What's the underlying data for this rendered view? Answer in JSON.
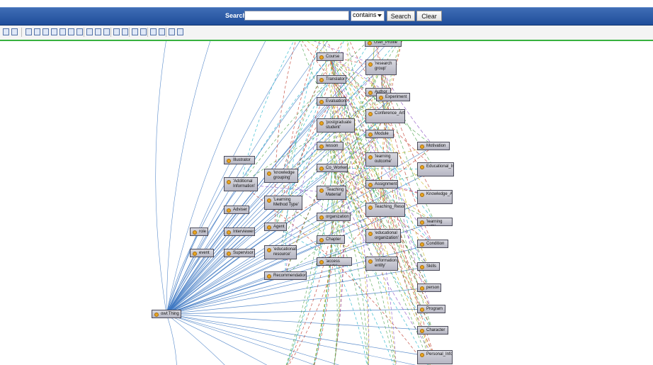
{
  "search": {
    "label": "Search:",
    "value": "",
    "mode": "contains",
    "search_button": "Search",
    "clear_button": "Clear"
  },
  "toolbar": {
    "icons": [
      "collapse-icon",
      "expand-icon",
      "list-icon",
      "tree-icon",
      "layout-icon",
      "triangle-layout-icon",
      "left-layout-icon",
      "center-layout-icon",
      "right-layout-icon",
      "zoom-in-icon",
      "zoom-out-icon",
      "zoom-fit-icon",
      "hierarchy-icon",
      "filter-icon",
      "camera-icon",
      "save-icon",
      "save-image-icon",
      "open-icon",
      "export-icon",
      "options-icon"
    ]
  },
  "colors": {
    "header": "#2a5ba8",
    "toolbar_accent": "#38b13f",
    "node_dot": "#e8a521",
    "edge_blue": "#3c77c2",
    "edge_red": "#c0392b",
    "edge_green": "#4aa14a",
    "edge_purple": "#8a4fc2",
    "edge_cyan": "#19b3c9",
    "edge_yellow": "#c9b21a"
  },
  "graph": {
    "nodes": [
      {
        "id": "userprofile",
        "label": "User_Profile"
      },
      {
        "id": "course",
        "label": "Course"
      },
      {
        "id": "researchgroup",
        "label": "'research group'"
      },
      {
        "id": "translator",
        "label": "Translator"
      },
      {
        "id": "author",
        "label": "Author"
      },
      {
        "id": "experiment",
        "label": "Experiment"
      },
      {
        "id": "evaluation",
        "label": "Evaluation"
      },
      {
        "id": "conference",
        "label": "Conference_Article"
      },
      {
        "id": "postgrad",
        "label": "'postgraduate student'"
      },
      {
        "id": "module",
        "label": "Module"
      },
      {
        "id": "lesson",
        "label": "lesson"
      },
      {
        "id": "learningoutcome",
        "label": "'learning outcome'"
      },
      {
        "id": "motivation",
        "label": "Motivation"
      },
      {
        "id": "illustrator",
        "label": "Illustrator"
      },
      {
        "id": "coworker",
        "label": "Co_Worker"
      },
      {
        "id": "educinfo",
        "label": "Educational_Information"
      },
      {
        "id": "knowledgegrouping",
        "label": "'knowledge grouping'"
      },
      {
        "id": "addinfo",
        "label": "'Additional Information'"
      },
      {
        "id": "teachingmaterial",
        "label": "'Teaching Material'"
      },
      {
        "id": "assignment",
        "label": "Assignment"
      },
      {
        "id": "knowledgeability",
        "label": "Knowledge_Ability"
      },
      {
        "id": "lmt",
        "label": "'Learning Method Type'"
      },
      {
        "id": "adviser",
        "label": "Adviser"
      },
      {
        "id": "teachingresource",
        "label": "Teaching_Resource"
      },
      {
        "id": "organization",
        "label": "organization"
      },
      {
        "id": "learningpath",
        "label": "'learning path'"
      },
      {
        "id": "agent",
        "label": "Agent"
      },
      {
        "id": "role",
        "label": "role"
      },
      {
        "id": "interviewer",
        "label": "Interviewer"
      },
      {
        "id": "chapter",
        "label": "Chapter"
      },
      {
        "id": "educorg",
        "label": "'educational organization'"
      },
      {
        "id": "condition",
        "label": "Condition"
      },
      {
        "id": "event",
        "label": "event"
      },
      {
        "id": "supervisor",
        "label": "Supervisor"
      },
      {
        "id": "eduresource",
        "label": "'educational resource'"
      },
      {
        "id": "accessmode",
        "label": "'access mode'"
      },
      {
        "id": "infoentity",
        "label": "'Information entity'"
      },
      {
        "id": "skills",
        "label": "Skills"
      },
      {
        "id": "recommendation",
        "label": "Recommendation"
      },
      {
        "id": "person",
        "label": "person"
      },
      {
        "id": "owlthing",
        "label": "owl:Thing"
      },
      {
        "id": "program",
        "label": "Program"
      },
      {
        "id": "character",
        "label": "Character"
      },
      {
        "id": "personalinfo",
        "label": "Personal_Information"
      }
    ]
  }
}
